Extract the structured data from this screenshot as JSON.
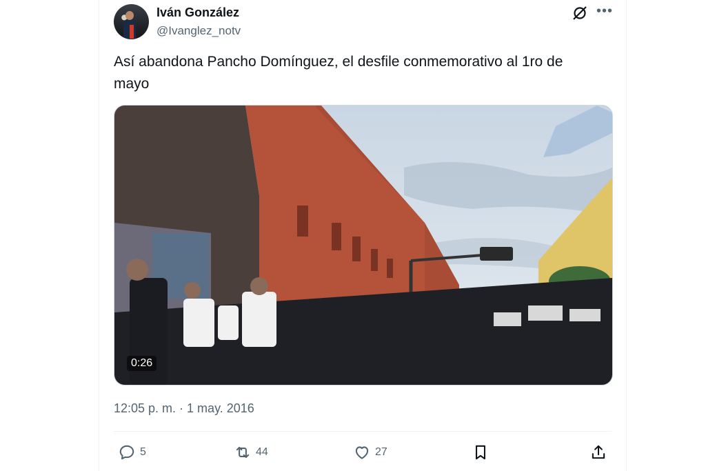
{
  "author": {
    "display_name": "Iván González",
    "handle": "@Ivanglez_notv"
  },
  "tweet": {
    "text": "Así abandona Pancho Domínguez, el desfile conmemorativo al 1ro de mayo",
    "timestamp": "12:05 p. m. · 1 may. 2016"
  },
  "video": {
    "duration": "0:26"
  },
  "actions": {
    "replies": "5",
    "retweets": "44",
    "likes": "27"
  },
  "icons": {
    "grok": "grok-icon",
    "more": "more-icon",
    "reply": "reply-icon",
    "retweet": "retweet-icon",
    "like": "heart-icon",
    "bookmark": "bookmark-icon",
    "share": "share-icon"
  },
  "colors": {
    "text_primary": "#0f1419",
    "text_secondary": "#536471",
    "border": "#eff3f4"
  }
}
